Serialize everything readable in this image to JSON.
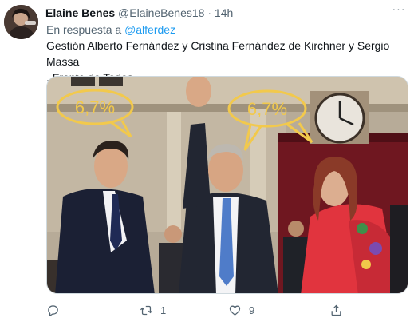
{
  "tweet": {
    "display_name": "Elaine Benes",
    "handle": "@ElaineBenes18",
    "separator": "·",
    "time": "14h",
    "reply_prefix": "En respuesta a",
    "reply_mention": "@alferdez",
    "text_line1": "Gestión Alberto Fernández y Cristina Fernández de Kirchner y Sergio Massa",
    "text_line2": ". Frente de Todos",
    "more_label": "···"
  },
  "media": {
    "bubble_left": "6,7%",
    "bubble_right": "6,7%",
    "bubble_color": "#f2c94c"
  },
  "actions": {
    "reply_count": "",
    "retweet_count": "1",
    "like_count": "9",
    "share_count": ""
  },
  "colors": {
    "accent": "#1d9bf0",
    "secondary_text": "#536471",
    "primary_text": "#0f1419"
  }
}
